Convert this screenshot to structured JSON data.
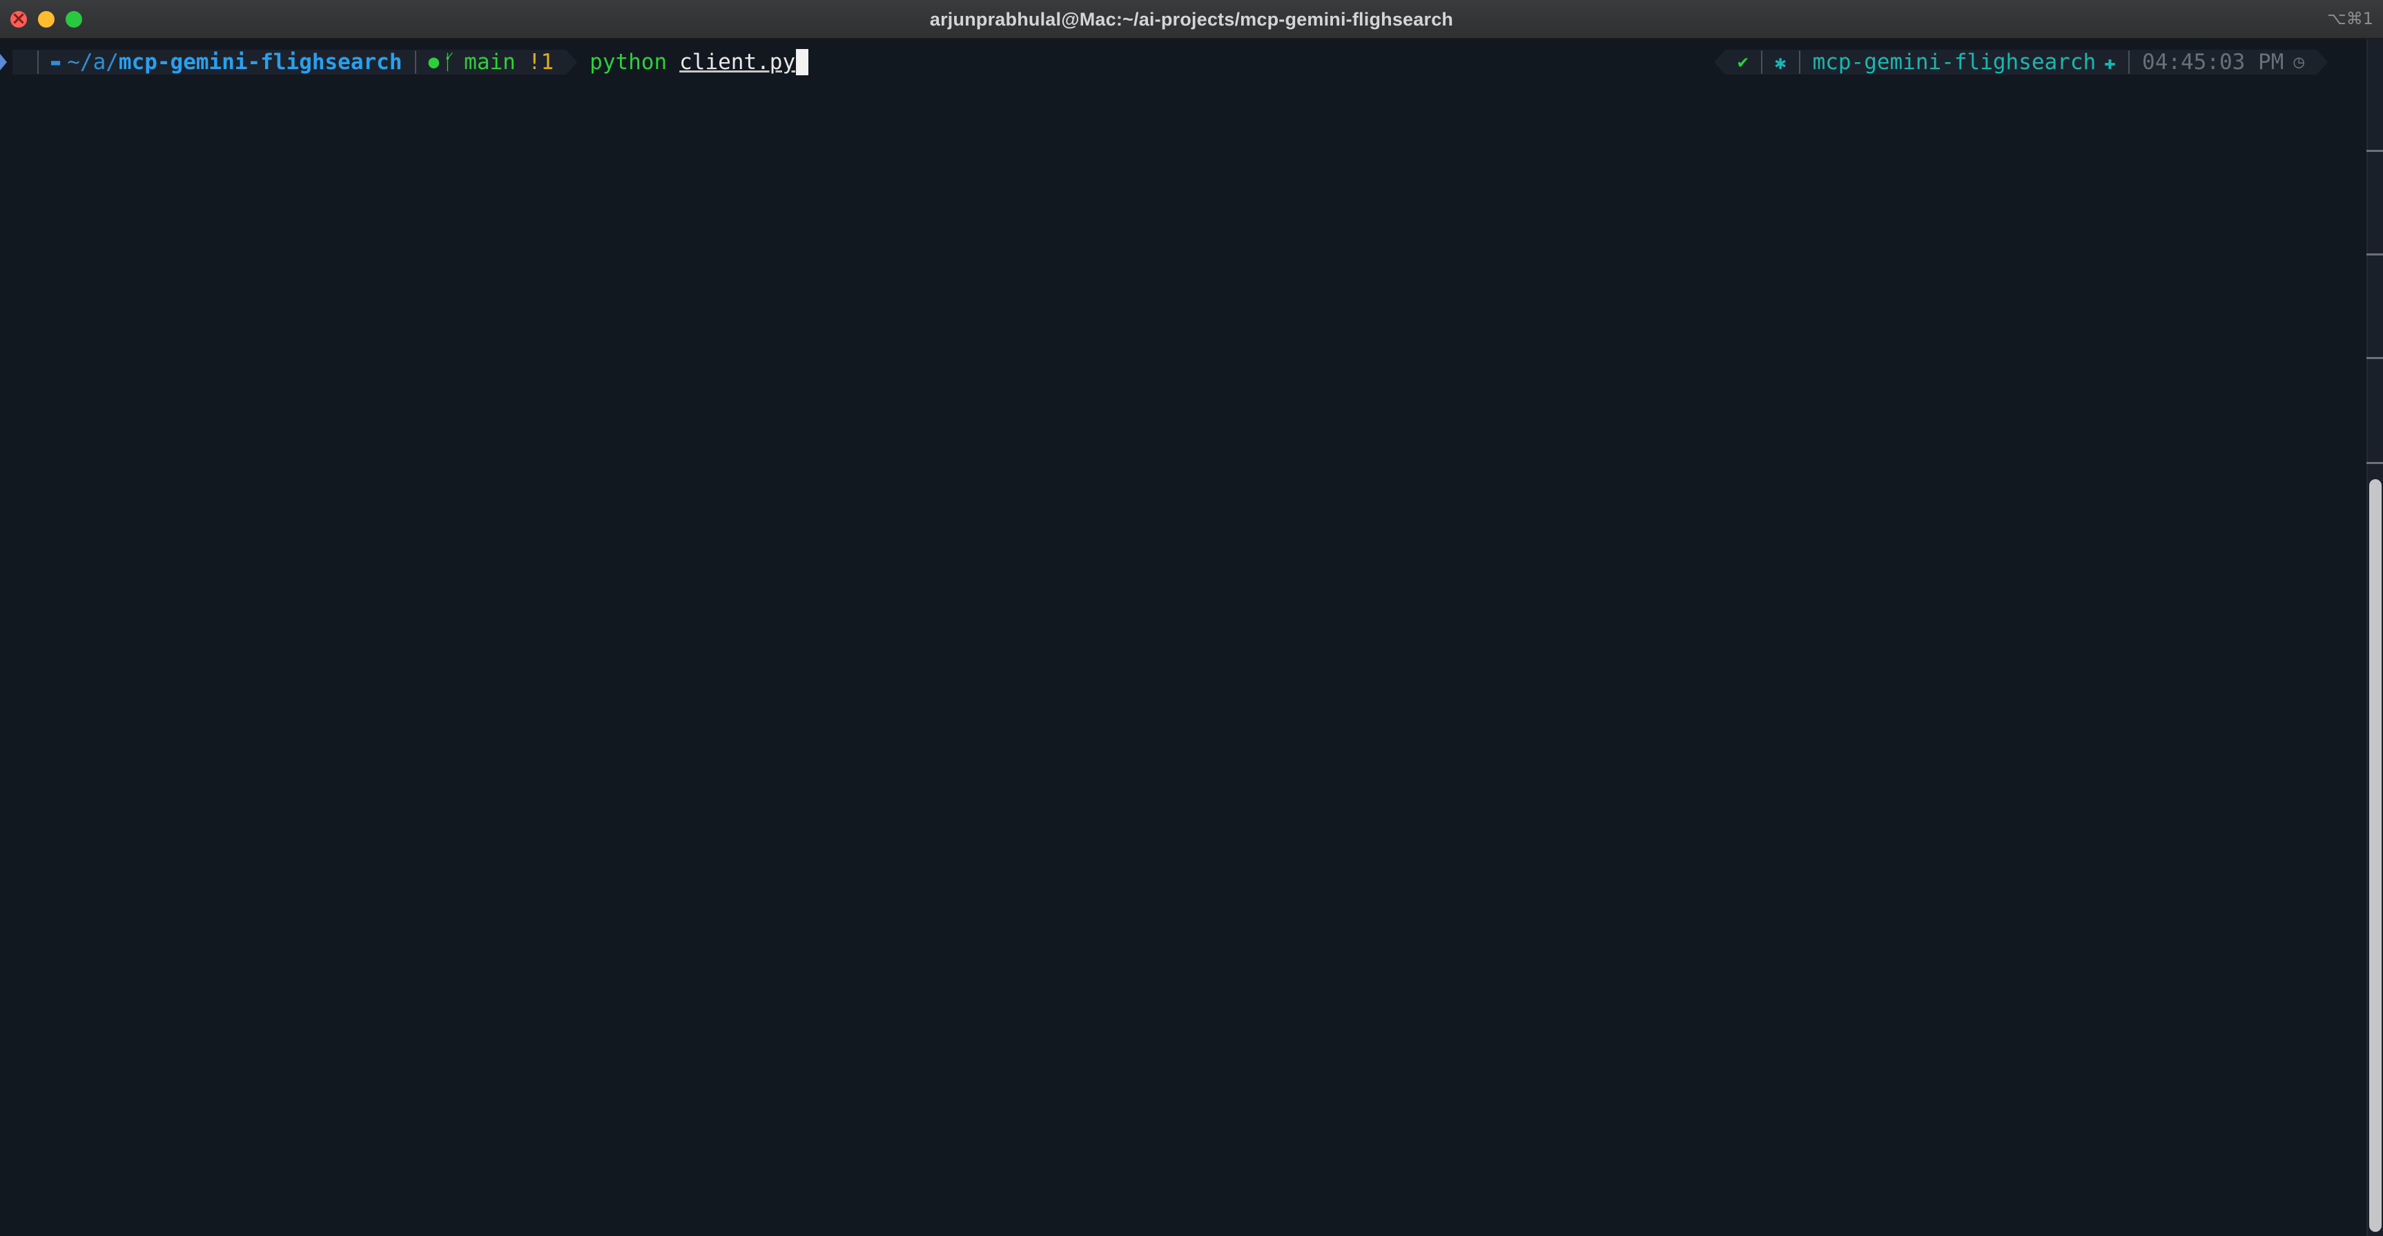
{
  "window": {
    "title": "arjunprabhulal@Mac:~/ai-projects/mcp-gemini-flighsearch",
    "shortcut": "⌥⌘1"
  },
  "prompt": {
    "os_icon": "apple-icon",
    "folder_icon": "folder-icon",
    "path_prefix": "~/a/",
    "path_current": "mcp-gemini-flighsearch",
    "git_icon": "github-icon",
    "branch_icon": "git-branch-icon",
    "branch": "main",
    "git_status": "!1",
    "command": "python",
    "argument": "client.py"
  },
  "right_prompt": {
    "status_icon": "checkmark-icon",
    "settings_icon": "gear-icon",
    "virtualenv": "mcp-gemini-flighsearch",
    "python_icon": "python-icon",
    "time": "04:45:03 PM",
    "clock_icon": "clock-icon"
  },
  "colors": {
    "background": "#121820",
    "path": "#27a1f0",
    "branch": "#2bd13b",
    "dirty": "#e5ab1e",
    "env": "#17b8b2",
    "time": "#6a7079"
  }
}
